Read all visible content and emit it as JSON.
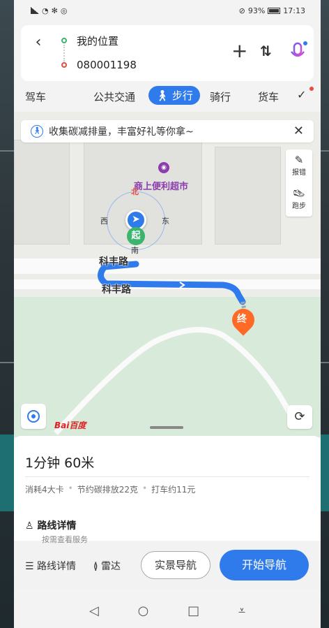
{
  "status": {
    "battery": "93%",
    "time": "17:13"
  },
  "route": {
    "start": "我的位置",
    "end": "080001198"
  },
  "modes": [
    "驾车",
    "公共交通",
    "步行",
    "骑行",
    "货车"
  ],
  "active_mode": "步行",
  "banner": {
    "text": "收集碳减排量，丰富好礼等你拿~"
  },
  "side_tools": {
    "feedback": "报错",
    "run": "跑步"
  },
  "map": {
    "poi": "商上便利超市",
    "road1": "科丰路",
    "road2": "科丰路",
    "compass": {
      "n": "北",
      "w": "西",
      "e": "东",
      "s": "南"
    },
    "start_marker": "起",
    "end_marker": "终",
    "logo": "Bai百度"
  },
  "summary": {
    "duration": "1分钟  60米",
    "calories": "消耗4大卡",
    "carbon": "节约碳排放22克",
    "taxi": "打车约11元",
    "detail_title": "路线详情",
    "detail_sub": "按需查看服务"
  },
  "actions": {
    "route_detail": "路线详情",
    "radar": "雷达",
    "real_nav": "实景导航",
    "start_nav": "开始导航"
  }
}
